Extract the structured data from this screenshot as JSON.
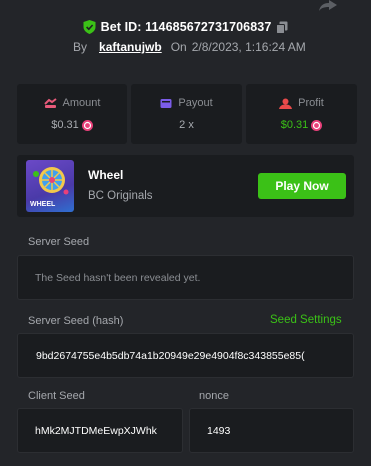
{
  "header": {
    "bet_id": "Bet ID: 114685672731706837",
    "by_label": "By",
    "username": "kaftanujwb",
    "on_label": "On",
    "date": "2/8/2023, 1:16:24 AM"
  },
  "stats": {
    "amount": {
      "label": "Amount",
      "value": "$0.31"
    },
    "payout": {
      "label": "Payout",
      "value": "2 x"
    },
    "profit": {
      "label": "Profit",
      "value": "$0.31"
    }
  },
  "game": {
    "name": "Wheel",
    "provider": "BC Originals",
    "thumb_text": "WHEEL",
    "play_label": "Play Now"
  },
  "server_seed": {
    "label": "Server Seed",
    "value": "The Seed hasn't been revealed yet."
  },
  "server_seed_hash": {
    "label": "Server Seed (hash)",
    "settings_label": "Seed Settings",
    "value": "9bd2674755e4b5db74a1b20949e29e4904f8c343855e85("
  },
  "client_seed": {
    "label": "Client Seed",
    "value": "hMk2MJTDMeEwpXJWhk"
  },
  "nonce": {
    "label": "nonce",
    "value": "1493"
  },
  "colors": {
    "accent_green": "#3bc117",
    "bg_panel": "#232529",
    "bg_card": "#1a1c1f",
    "text_muted": "#a5a8ad"
  }
}
